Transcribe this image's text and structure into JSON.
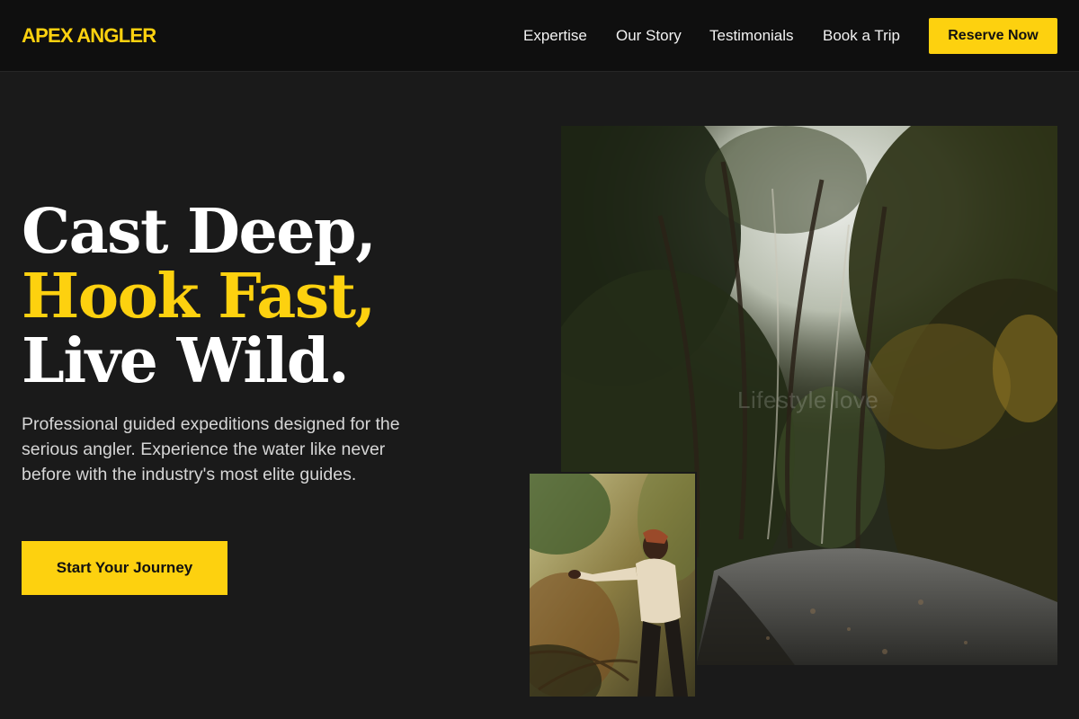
{
  "header": {
    "logo": "APEX ANGLER",
    "nav": [
      {
        "label": "Expertise"
      },
      {
        "label": "Our Story"
      },
      {
        "label": "Testimonials"
      },
      {
        "label": "Book a Trip"
      }
    ],
    "cta_label": "Reserve Now"
  },
  "hero": {
    "headline_line1": "Cast Deep,",
    "headline_line2": "Hook Fast,",
    "headline_line3": "Live Wild.",
    "description": "Professional guided expeditions designed for the serious angler. Experience the water like never before with the industry's most elite guides.",
    "cta_label": "Start Your Journey"
  },
  "images": {
    "main_watermark": "Lifestyle love",
    "main_alt": "forest-trail-photo",
    "inset_alt": "angler-in-forest-photo"
  },
  "colors": {
    "accent": "#fdd10f",
    "background": "#1a1a1a",
    "header_bg": "#0f0f0f"
  }
}
